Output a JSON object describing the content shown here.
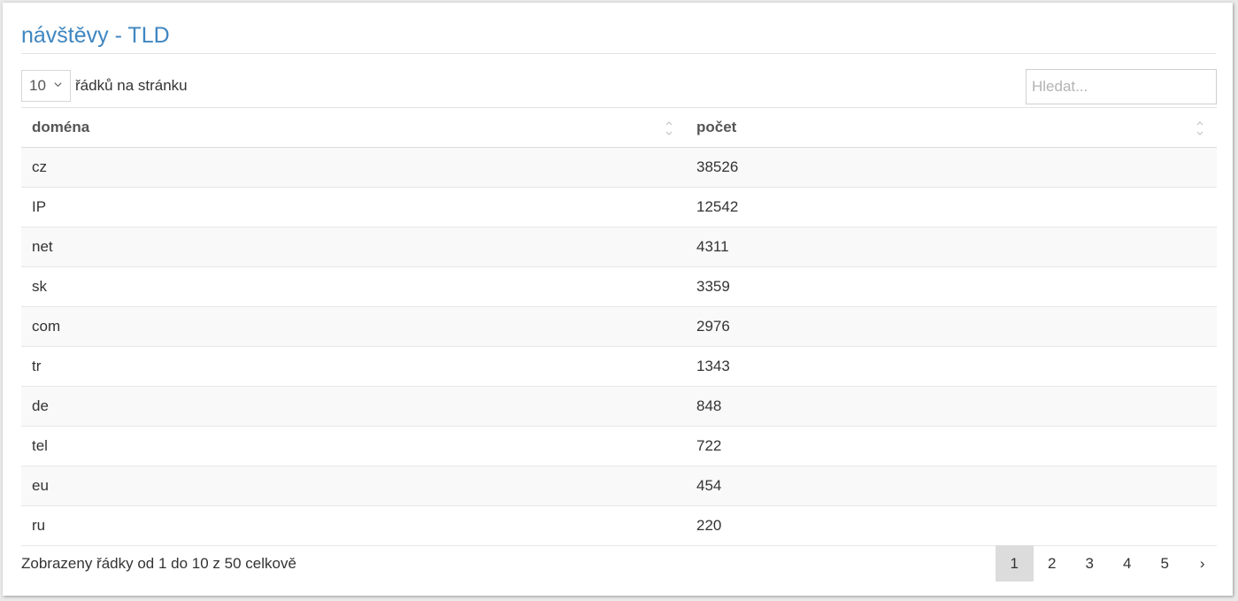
{
  "title": "návštěvy - TLD",
  "length": {
    "selected": "10",
    "label": "řádků na stránku"
  },
  "search": {
    "placeholder": "Hledat...",
    "value": ""
  },
  "table": {
    "columns": [
      "doména",
      "počet"
    ],
    "rows": [
      [
        "cz",
        "38526"
      ],
      [
        "IP",
        "12542"
      ],
      [
        "net",
        "4311"
      ],
      [
        "sk",
        "3359"
      ],
      [
        "com",
        "2976"
      ],
      [
        "tr",
        "1343"
      ],
      [
        "de",
        "848"
      ],
      [
        "tel",
        "722"
      ],
      [
        "eu",
        "454"
      ],
      [
        "ru",
        "220"
      ]
    ]
  },
  "info": "Zobrazeny řádky od 1 do 10 z 50 celkově",
  "pagination": {
    "pages": [
      "1",
      "2",
      "3",
      "4",
      "5"
    ],
    "active": "1",
    "next": "›"
  },
  "colors": {
    "title": "#3f86c0",
    "active_page": "#dcdcdc",
    "stripe": "#f9f9f9"
  },
  "icons": {
    "select_caret": "chevron-down-icon",
    "sort": "sort-both-icon"
  }
}
